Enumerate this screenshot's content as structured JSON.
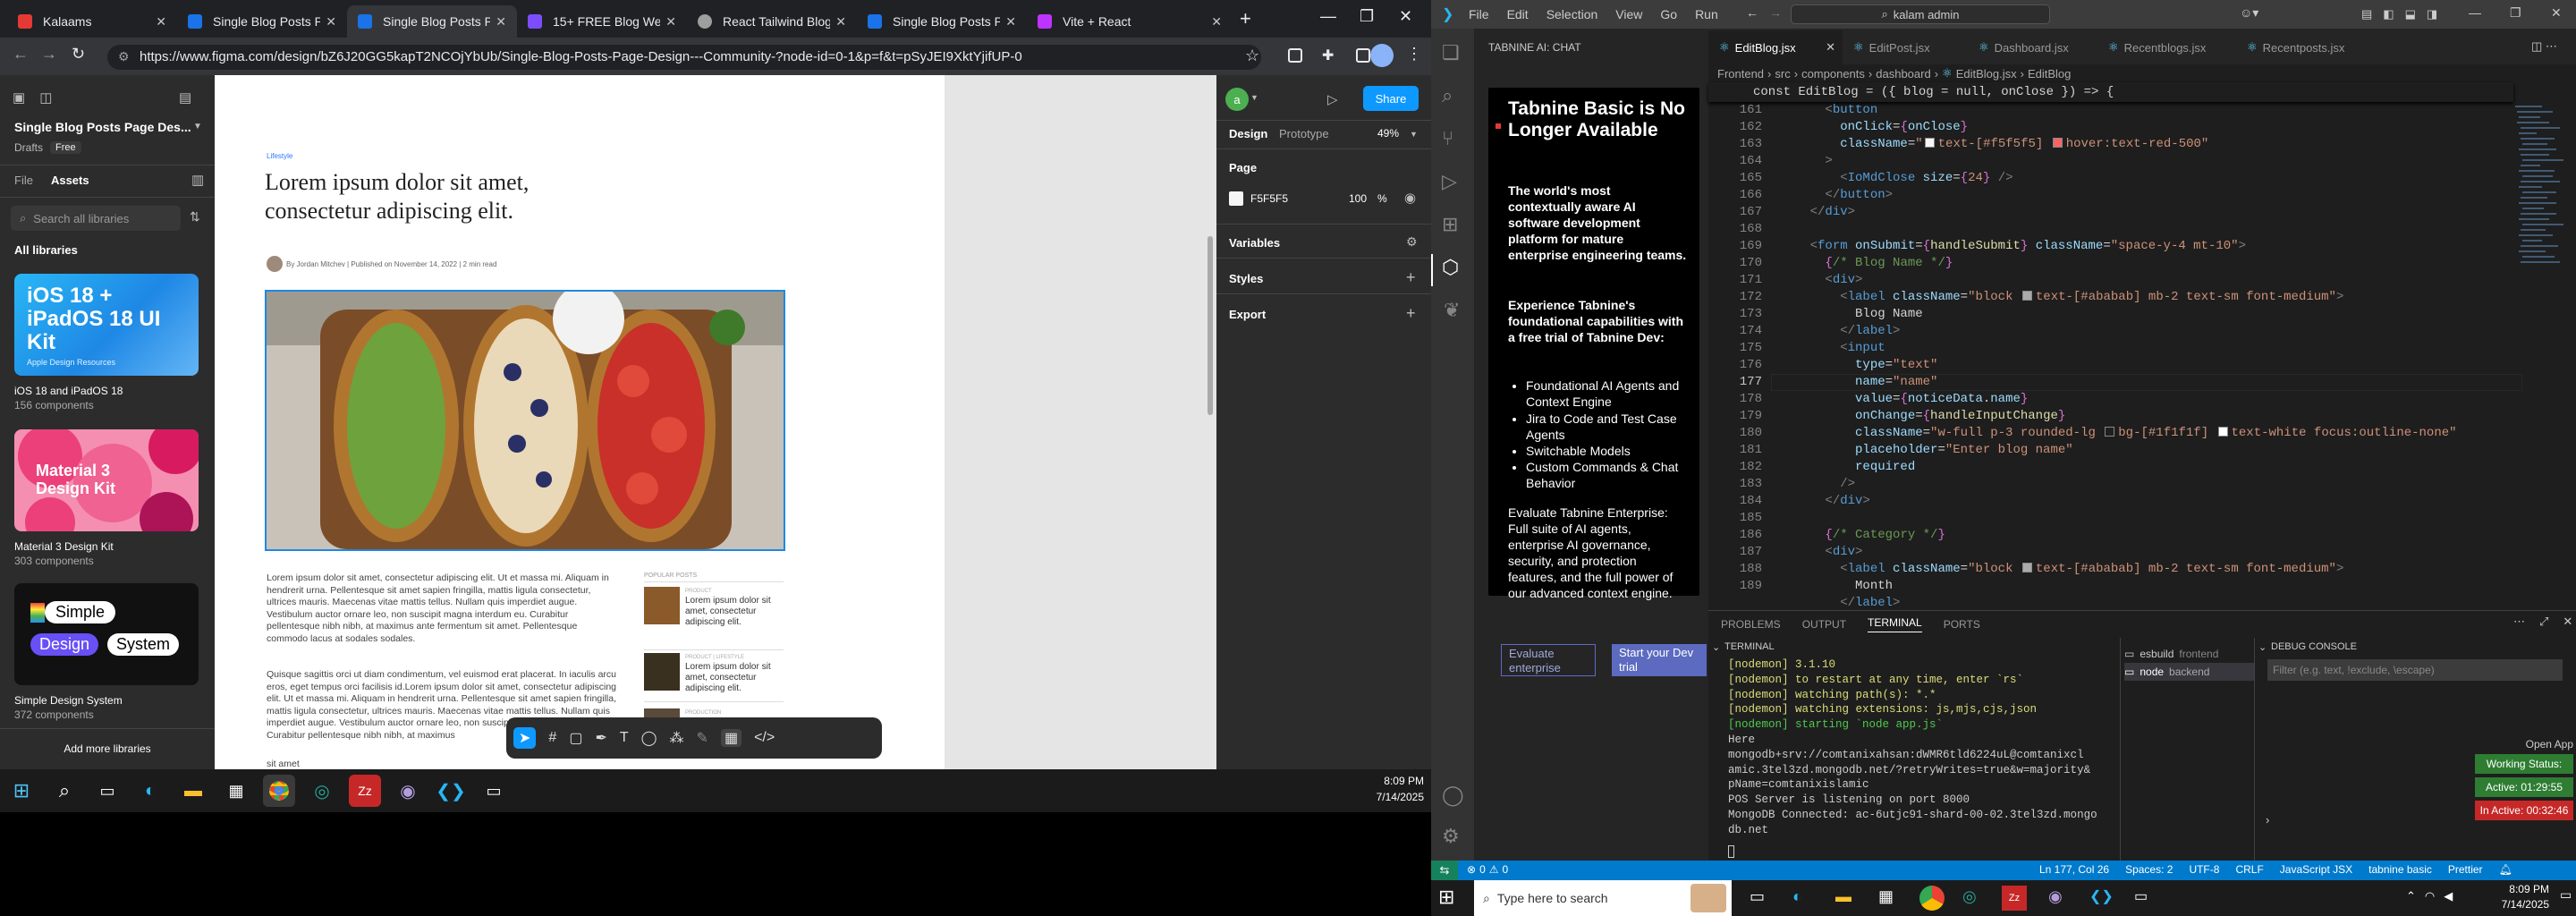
{
  "browser": {
    "tabs": [
      {
        "label": "Kalaams",
        "fav_color": "#e53935"
      },
      {
        "label": "Single Blog Posts Page",
        "fav_color": "#1a73e8"
      },
      {
        "label": "Single Blog Posts Page",
        "fav_color": "#1a73e8"
      },
      {
        "label": "15+ FREE Blog Website",
        "fav_color": "#7c4dff"
      },
      {
        "label": "React Tailwind Blog Co",
        "fav_color": "#9e9e9e"
      },
      {
        "label": "Single Blog Posts Page",
        "fav_color": "#1a73e8"
      },
      {
        "label": "Vite + React",
        "fav_color": "#bd34fe"
      }
    ],
    "url": "https://www.figma.com/design/bZ6J20GG5kapT2NCOjYbUb/Single-Blog-Posts-Page-Design---Community-?node-id=0-1&p=f&t=pSyJEI9XktYjifUP-0"
  },
  "figma": {
    "file_title": "Single Blog Posts Page Des...",
    "drafts": "Drafts",
    "plan": "Free",
    "tab_file": "File",
    "tab_assets": "Assets",
    "search_placeholder": "Search all libraries",
    "all_libraries": "All libraries",
    "kits": [
      {
        "name": "iOS 18 and iPadOS 18",
        "count": "156 components",
        "art": "iOS 18 + iPadOS 18 UI Kit",
        "art_sub": "Apple Design Resources"
      },
      {
        "name": "Material 3 Design Kit",
        "count": "303 components",
        "art": "Material 3 Design Kit"
      },
      {
        "name": "Simple Design System",
        "count": "372 components",
        "art1": "Simple",
        "art2": "Design",
        "art3": "System"
      }
    ],
    "add_more": "Add more libraries",
    "canvas": {
      "breadcrumb": "Lifestyle",
      "title": "Lorem ipsum dolor sit amet, consectetur adipiscing elit.",
      "byline": "By Jordan Mitchev | Published on November 14, 2022 | 2 min read",
      "body1": "Lorem ipsum dolor sit amet, consectetur adipiscing elit. Ut et massa mi. Aliquam in hendrerit urna. Pellentesque sit amet sapien fringilla, mattis ligula consectetur, ultrices mauris. Maecenas vitae mattis tellus. Nullam quis imperdiet augue. Vestibulum auctor ornare leo, non suscipit magna interdum eu. Curabitur pellentesque nibh nibh, at maximus ante fermentum sit amet. Pellentesque commodo lacus at sodales sodales.",
      "body2": "Quisque sagittis orci ut diam condimentum, vel euismod erat placerat. In iaculis arcu eros, eget tempus orci facilisis id.Lorem ipsum dolor sit amet, consectetur adipiscing elit. Ut et massa mi. Aliquam in hendrerit urna. Pellentesque sit amet sapien fringilla, mattis ligula consectetur, ultrices mauris. Maecenas vitae mattis tellus. Nullam quis imperdiet augue. Vestibulum auctor ornare leo, non suscipit magna interdum eu. Curabitur pellentesque nibh nibh, at maximus",
      "body_cut": "sit amet",
      "popular": "POPULAR POSTS",
      "posts": [
        {
          "cat": "PRODUCT",
          "title": "Lorem ipsum dolor sit amet, consectetur adipiscing elit."
        },
        {
          "cat": "PRODUCT | LIFESTYLE",
          "title": "Lorem ipsum dolor sit amet, consectetur adipiscing elit."
        },
        {
          "cat": "PRODUCTION",
          "title": ""
        }
      ]
    },
    "right": {
      "tab_design": "Design",
      "tab_prototype": "Prototype",
      "zoom": "49%",
      "share": "Share",
      "page_label": "Page",
      "page_color": "F5F5F5",
      "page_opacity": "100",
      "page_pct": "%",
      "variables": "Variables",
      "styles": "Styles",
      "export": "Export",
      "avatar": "a"
    }
  },
  "taskbar_left": {
    "time": "8:09 PM",
    "date": "7/14/2025"
  },
  "vscode": {
    "chat_title": "TABNINE AI: CHAT",
    "card": {
      "heading": "Tabnine Basic is No Longer Available",
      "p1": "The world's most contextually aware AI software development platform for mature enterprise engineering teams.",
      "p2": "Experience Tabnine's foundational capabilities with a free trial of Tabnine Dev:",
      "bullets": [
        "Foundational AI Agents and Context Engine",
        "Jira to Code and Test Case Agents",
        "Switchable Models",
        "Custom Commands & Chat Behavior"
      ],
      "p3": "Evaluate Tabnine Enterprise: Full suite of AI agents, enterprise AI governance, security, and protection features, and the full power of our advanced context engine.",
      "btn1": "Evaluate enterprise",
      "btn2": "Start your Dev trial"
    },
    "menu": [
      "File",
      "Edit",
      "Selection",
      "View",
      "Go",
      "Run"
    ],
    "search": "kalam admin",
    "tabs": [
      "EditBlog.jsx",
      "EditPost.jsx",
      "Dashboard.jsx",
      "Recentblogs.jsx",
      "Recentposts.jsx"
    ],
    "breadcrumb": [
      "Frontend",
      "src",
      "components",
      "dashboard",
      "EditBlog.jsx",
      "EditBlog"
    ],
    "sticky": "const EditBlog = ({ blog = null, onClose }) => {",
    "lines": [
      161,
      162,
      163,
      164,
      165,
      166,
      167,
      168,
      169,
      170,
      171,
      172,
      173,
      174,
      175,
      176,
      177,
      178,
      179,
      180,
      181,
      182,
      183,
      184,
      185,
      186,
      187,
      188,
      189
    ],
    "panel_tabs": [
      "PROBLEMS",
      "OUTPUT",
      "TERMINAL",
      "PORTS"
    ],
    "terminal_title": "TERMINAL",
    "terminal": [
      "[nodemon] 3.1.10",
      "[nodemon] to restart at any time, enter `rs`",
      "[nodemon] watching path(s): *.*",
      "[nodemon] watching extensions: js,mjs,cjs,json",
      "[nodemon] starting `node app.js`",
      "Here",
      "mongodb+srv://comtanixahsan:dWMR6tld6224uL@comtanixcl",
      "amic.3tel3zd.mongodb.net/?retryWrites=true&w=majority&",
      "pName=comtanixislamic",
      "POS Server is listening on port 8000",
      "MongoDB Connected: ac-6utjc91-shard-00-02.3tel3zd.mongo",
      "db.net"
    ],
    "term_list": [
      {
        "name": "esbuild",
        "dir": "frontend"
      },
      {
        "name": "node",
        "dir": "backend"
      }
    ],
    "debug_title": "DEBUG CONSOLE",
    "debug_filter": "Filter (e.g. text, !exclude, \\escape)",
    "open_app": "Open App",
    "status_pills": [
      "Working Status: Active",
      "Active: 01:29:55",
      "In Active: 00:32:46"
    ],
    "statusbar": {
      "errors": "0",
      "warnings": "0",
      "pos": "Ln 177, Col 26",
      "spaces": "Spaces: 2",
      "enc": "UTF-8",
      "eol": "CRLF",
      "lang": "JavaScript JSX",
      "tabnine": "tabnine basic",
      "prettier": "Prettier"
    },
    "taskbar": {
      "search": "Type here to search",
      "time": "8:09 PM",
      "date": "7/14/2025"
    }
  }
}
